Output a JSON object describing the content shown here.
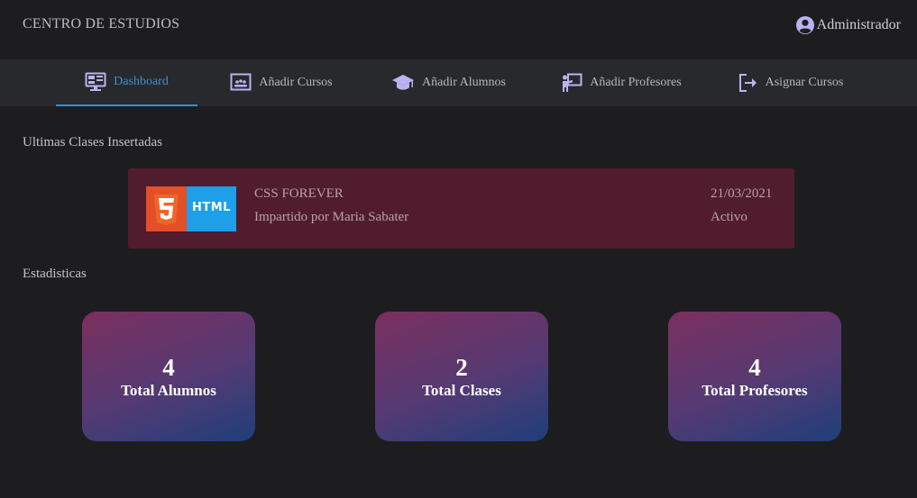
{
  "header": {
    "brand": "CENTRO DE ESTUDIOS",
    "user_label": "Administrador",
    "user_icon": "user-circle-icon"
  },
  "nav": {
    "items": [
      {
        "label": "Dashboard",
        "icon": "dashboard-monitor-icon",
        "active": true
      },
      {
        "label": "Añadir Cursos",
        "icon": "add-course-board-icon",
        "active": false
      },
      {
        "label": "Añadir Alumnos",
        "icon": "graduation-cap-icon",
        "active": false
      },
      {
        "label": "Añadir Profesores",
        "icon": "teacher-board-icon",
        "active": false
      },
      {
        "label": "Asignar Cursos",
        "icon": "assign-exit-icon",
        "active": false
      }
    ],
    "active_color": "#3d8fd1"
  },
  "latest": {
    "title": "Ultimas Clases Insertadas",
    "classes": [
      {
        "thumb_text": "HTML",
        "thumb_icon": "html5-logo-icon",
        "name": "CSS FOREVER",
        "teacher": "Impartido por Maria Sabater",
        "date": "21/03/2021",
        "status": "Activo"
      }
    ]
  },
  "stats": {
    "title": "Estadisticas",
    "cards": [
      {
        "value": "4",
        "label": "Total Alumnos"
      },
      {
        "value": "2",
        "label": "Total Clases"
      },
      {
        "value": "4",
        "label": "Total Profesores"
      }
    ]
  },
  "colors": {
    "background": "#1d1d20",
    "navbar": "#27292c",
    "class_card": "#521c2f",
    "stat_gradient_start": "#7b2f5e",
    "stat_gradient_end": "#1f3e7a"
  }
}
